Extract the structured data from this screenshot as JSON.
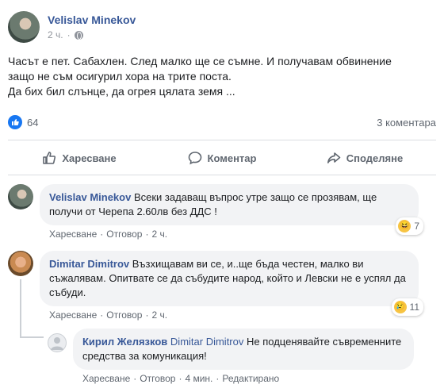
{
  "post": {
    "author": "Velislav Minekov",
    "time": "2 ч.",
    "body_lines": [
      "Часът е пет. Сабахлен. След малко ще се съмне. И получавам обвинение",
      "защо не съм осигурил хора на трите поста.",
      "Да бих бил слънце, да огрея цялата земя ..."
    ],
    "like_count": "64",
    "comment_count": "3 коментара"
  },
  "actions": {
    "like": "Харесване",
    "comment": "Коментар",
    "share": "Споделяне"
  },
  "comments": [
    {
      "author": "Velislav Minekov",
      "text": "Всеки задаващ въпрос утре защо се прозявам, ще получи от Черепа 2.60лв без ДДС !",
      "like": "Харесване",
      "reply": "Отговор",
      "time": "2 ч.",
      "reaction_count": "7"
    },
    {
      "author": "Dimitar Dimitrov",
      "text": "Възхищавам ви се, и..ще бъда честен, малко ви съжалявам. Опитвате се да събудите народ, който и Левски не е успял да събуди.",
      "like": "Харесване",
      "reply": "Отговор",
      "time": "2 ч.",
      "reaction_count": "11"
    },
    {
      "author": "Кирил Желязков",
      "mention": "Dimitar Dimitrov",
      "text": "Не подценявайте съвременните средства за комуникация!",
      "like": "Харесване",
      "reply": "Отговор",
      "time": "4 мин.",
      "edited": "Редактирано"
    }
  ],
  "icons": {
    "globe": "globe-icon",
    "like": "thumbs-up-icon",
    "comment": "speech-bubble-icon",
    "share": "share-arrow-icon"
  },
  "colors": {
    "link": "#385898",
    "like_blue": "#1877f2",
    "bubble": "#f2f3f5",
    "muted": "#606770"
  }
}
